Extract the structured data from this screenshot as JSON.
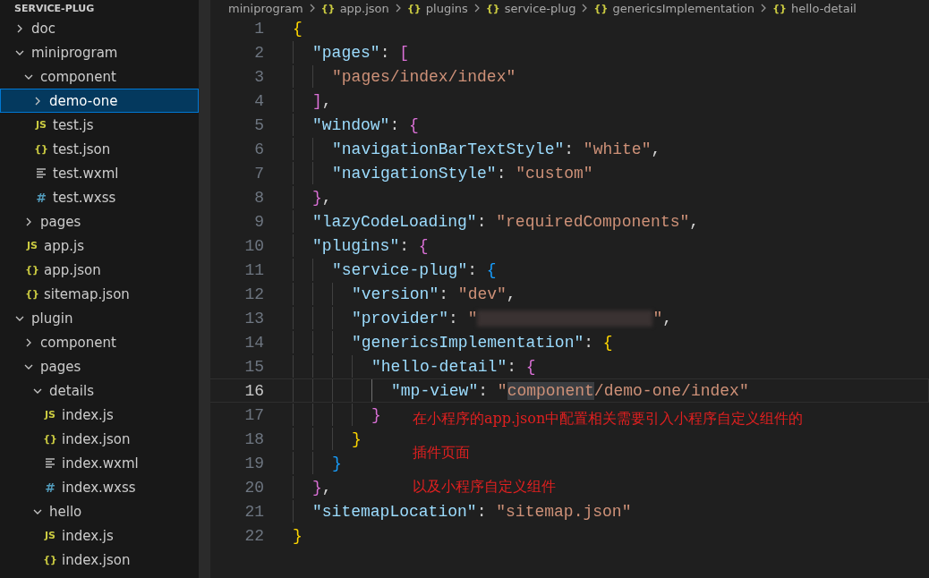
{
  "explorer": {
    "title": "SERVICE-PLUG",
    "tree": [
      {
        "label": "doc",
        "kind": "folder",
        "expanded": false,
        "selected": false
      },
      {
        "label": "miniprogram",
        "kind": "folder",
        "expanded": true,
        "selected": false,
        "children": [
          {
            "label": "component",
            "kind": "folder",
            "expanded": true,
            "selected": false,
            "children": [
              {
                "label": "demo-one",
                "kind": "folder",
                "expanded": false,
                "selected": true
              },
              {
                "label": "test.js",
                "kind": "js",
                "icon": "JS",
                "selected": false
              },
              {
                "label": "test.json",
                "kind": "json",
                "icon": "{}",
                "selected": false
              },
              {
                "label": "test.wxml",
                "kind": "wxml",
                "selected": false
              },
              {
                "label": "test.wxss",
                "kind": "wxss",
                "icon": "#",
                "selected": false
              }
            ]
          },
          {
            "label": "pages",
            "kind": "folder",
            "expanded": false,
            "selected": false
          },
          {
            "label": "app.js",
            "kind": "js",
            "icon": "JS",
            "selected": false
          },
          {
            "label": "app.json",
            "kind": "json",
            "icon": "{}",
            "selected": false
          },
          {
            "label": "sitemap.json",
            "kind": "json",
            "icon": "{}",
            "selected": false
          }
        ]
      },
      {
        "label": "plugin",
        "kind": "folder",
        "expanded": true,
        "selected": false,
        "children": [
          {
            "label": "component",
            "kind": "folder",
            "expanded": false,
            "selected": false
          },
          {
            "label": "pages",
            "kind": "folder",
            "expanded": true,
            "selected": false,
            "children": [
              {
                "label": "details",
                "kind": "folder",
                "expanded": true,
                "selected": false,
                "children": [
                  {
                    "label": "index.js",
                    "kind": "js",
                    "icon": "JS",
                    "selected": false
                  },
                  {
                    "label": "index.json",
                    "kind": "json",
                    "icon": "{}",
                    "selected": false
                  },
                  {
                    "label": "index.wxml",
                    "kind": "wxml",
                    "selected": false
                  },
                  {
                    "label": "index.wxss",
                    "kind": "wxss",
                    "icon": "#",
                    "selected": false
                  }
                ]
              },
              {
                "label": "hello",
                "kind": "folder",
                "expanded": true,
                "selected": false,
                "children": [
                  {
                    "label": "index.js",
                    "kind": "js",
                    "icon": "JS",
                    "selected": false
                  },
                  {
                    "label": "index.json",
                    "kind": "json",
                    "icon": "{}",
                    "selected": false
                  }
                ]
              }
            ]
          }
        ]
      }
    ]
  },
  "breadcrumb": [
    {
      "label": "miniprogram",
      "kind": "folder"
    },
    {
      "label": "app.json",
      "kind": "json",
      "icon": "{}"
    },
    {
      "label": "plugins",
      "kind": "json",
      "icon": "{}"
    },
    {
      "label": "service-plug",
      "kind": "json",
      "icon": "{}"
    },
    {
      "label": "genericsImplementation",
      "kind": "json",
      "icon": "{}"
    },
    {
      "label": "hello-detail",
      "kind": "json",
      "icon": "{}"
    }
  ],
  "editor": {
    "lines": [
      {
        "number": "1",
        "current": false,
        "tokens": [
          {
            "text": "{",
            "kind": "open"
          }
        ]
      },
      {
        "number": "2",
        "current": false,
        "tokens": [
          {
            "text": "\"pages\"",
            "kind": "key"
          },
          {
            "text": ": ",
            "kind": "punct"
          },
          {
            "text": "[",
            "kind": "open"
          }
        ]
      },
      {
        "number": "3",
        "current": false,
        "tokens": [
          {
            "text": "\"pages/index/index\"",
            "kind": "string"
          }
        ]
      },
      {
        "number": "4",
        "current": false,
        "tokens": [
          {
            "text": "]",
            "kind": "close"
          },
          {
            "text": ",",
            "kind": "punct"
          }
        ]
      },
      {
        "number": "5",
        "current": false,
        "tokens": [
          {
            "text": "\"window\"",
            "kind": "key"
          },
          {
            "text": ": ",
            "kind": "punct"
          },
          {
            "text": "{",
            "kind": "open"
          }
        ]
      },
      {
        "number": "6",
        "current": false,
        "tokens": [
          {
            "text": "\"navigationBarTextStyle\"",
            "kind": "key"
          },
          {
            "text": ": ",
            "kind": "punct"
          },
          {
            "text": "\"white\"",
            "kind": "string"
          },
          {
            "text": ",",
            "kind": "punct"
          }
        ]
      },
      {
        "number": "7",
        "current": false,
        "tokens": [
          {
            "text": "\"navigationStyle\"",
            "kind": "key"
          },
          {
            "text": ": ",
            "kind": "punct"
          },
          {
            "text": "\"custom\"",
            "kind": "string"
          }
        ]
      },
      {
        "number": "8",
        "current": false,
        "tokens": [
          {
            "text": "}",
            "kind": "close"
          },
          {
            "text": ",",
            "kind": "punct"
          }
        ]
      },
      {
        "number": "9",
        "current": false,
        "tokens": [
          {
            "text": "\"lazyCodeLoading\"",
            "kind": "key"
          },
          {
            "text": ": ",
            "kind": "punct"
          },
          {
            "text": "\"requiredComponents\"",
            "kind": "string"
          },
          {
            "text": ",",
            "kind": "punct"
          }
        ]
      },
      {
        "number": "10",
        "current": false,
        "tokens": [
          {
            "text": "\"plugins\"",
            "kind": "key"
          },
          {
            "text": ": ",
            "kind": "punct"
          },
          {
            "text": "{",
            "kind": "open"
          }
        ]
      },
      {
        "number": "11",
        "current": false,
        "tokens": [
          {
            "text": "\"service-plug\"",
            "kind": "key"
          },
          {
            "text": ": ",
            "kind": "punct"
          },
          {
            "text": "{",
            "kind": "open"
          }
        ]
      },
      {
        "number": "12",
        "current": false,
        "tokens": [
          {
            "text": "\"version\"",
            "kind": "key"
          },
          {
            "text": ": ",
            "kind": "punct"
          },
          {
            "text": "\"dev\"",
            "kind": "string"
          },
          {
            "text": ",",
            "kind": "punct"
          }
        ]
      },
      {
        "number": "13",
        "current": false,
        "tokens": [
          {
            "text": "\"provider\"",
            "kind": "key"
          },
          {
            "text": ": ",
            "kind": "punct"
          },
          {
            "text": "\"",
            "kind": "string"
          },
          {
            "kind": "redacted"
          },
          {
            "text": "\"",
            "kind": "string"
          },
          {
            "text": ",",
            "kind": "punct"
          }
        ]
      },
      {
        "number": "14",
        "current": false,
        "tokens": [
          {
            "text": "\"genericsImplementation\"",
            "kind": "key"
          },
          {
            "text": ": ",
            "kind": "punct"
          },
          {
            "text": "{",
            "kind": "open"
          }
        ]
      },
      {
        "number": "15",
        "current": false,
        "tokens": [
          {
            "text": "\"hello-detail\"",
            "kind": "key"
          },
          {
            "text": ": ",
            "kind": "punct"
          },
          {
            "text": "{",
            "kind": "open"
          }
        ]
      },
      {
        "number": "16",
        "current": true,
        "tokens": [
          {
            "text": "\"mp-view\"",
            "kind": "key"
          },
          {
            "text": ": ",
            "kind": "punct"
          },
          {
            "text": "\"",
            "kind": "string"
          },
          {
            "text": "component",
            "kind": "string",
            "selected": true
          },
          {
            "text": "/demo-one/index\"",
            "kind": "string"
          }
        ]
      },
      {
        "number": "17",
        "current": false,
        "tokens": [
          {
            "text": "}",
            "kind": "close"
          }
        ]
      },
      {
        "number": "18",
        "current": false,
        "tokens": [
          {
            "text": "}",
            "kind": "close"
          }
        ]
      },
      {
        "number": "19",
        "current": false,
        "tokens": [
          {
            "text": "}",
            "kind": "close"
          }
        ]
      },
      {
        "number": "20",
        "current": false,
        "tokens": [
          {
            "text": "}",
            "kind": "close"
          },
          {
            "text": ",",
            "kind": "punct"
          }
        ]
      },
      {
        "number": "21",
        "current": false,
        "tokens": [
          {
            "text": "\"sitemapLocation\"",
            "kind": "key"
          },
          {
            "text": ": ",
            "kind": "punct"
          },
          {
            "text": "\"sitemap.json\"",
            "kind": "string"
          }
        ]
      },
      {
        "number": "22",
        "current": false,
        "tokens": [
          {
            "text": "}",
            "kind": "close"
          }
        ]
      }
    ],
    "annotation": [
      "在小程序的app.json中配置相关需要引入小程序自定义组件的",
      "插件页面",
      "以及小程序自定义组件"
    ]
  }
}
